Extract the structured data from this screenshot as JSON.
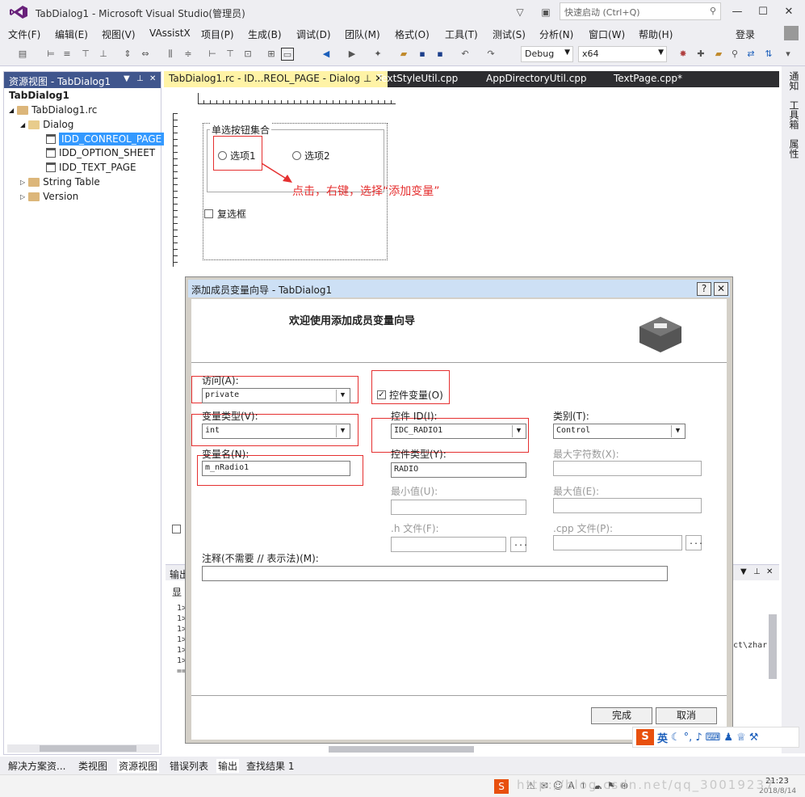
{
  "window": {
    "title": "TabDialog1 - Microsoft Visual Studio(管理员)",
    "quick_launch": "快速启动 (Ctrl+Q)"
  },
  "menu": [
    "文件(F)",
    "编辑(E)",
    "视图(V)",
    "VAssistX",
    "项目(P)",
    "生成(B)",
    "调试(D)",
    "团队(M)",
    "格式(O)",
    "工具(T)",
    "测试(S)",
    "分析(N)",
    "窗口(W)",
    "帮助(H)"
  ],
  "signin": "登录",
  "toolbar": {
    "config": "Debug",
    "platform": "x64"
  },
  "resource_view": {
    "title": "资源视图 - TabDialog1",
    "tree": [
      "TabDialog1",
      "TabDialog1.rc",
      "Dialog",
      "IDD_CONREOL_PAGE",
      "IDD_OPTION_SHEET",
      "IDD_TEXT_PAGE",
      "String Table",
      "Version"
    ]
  },
  "tabs": [
    "TabDialog1.rc - ID...REOL_PAGE - Dialog",
    "TextStyleUtil.cpp",
    "AppDirectoryUtil.cpp",
    "TextPage.cpp*"
  ],
  "right_tools": [
    "通知",
    "工具箱",
    "属性"
  ],
  "design": {
    "group_label": "单选按钮集合",
    "radio1": "选项1",
    "radio2": "选项2",
    "checkbox": "复选框",
    "annotation": "点击，右键，选择“添加变量”"
  },
  "output": {
    "header": "输出",
    "show": "显",
    "lines": [
      "1>",
      "1>",
      "1>",
      "1>",
      "1>",
      "1>",
      "=="
    ],
    "path_tail": "ct\\zhar"
  },
  "bottom_tabs": {
    "left": [
      "解决方案资...",
      "类视图",
      "资源视图"
    ],
    "right": [
      "错误列表",
      "输出",
      "查找结果 1"
    ]
  },
  "dialog": {
    "title": "添加成员变量向导 - TabDialog1",
    "help": "?",
    "close": "✕",
    "welcome": "欢迎使用添加成员变量向导",
    "access_label": "访问(A):",
    "access_value": "private",
    "control_var_label": "控件变量(O)",
    "var_type_label": "变量类型(V):",
    "var_type_value": "int",
    "control_id_label": "控件 ID(I):",
    "control_id_value": "IDC_RADIO1",
    "category_label": "类别(T):",
    "category_value": "Control",
    "var_name_label": "变量名(N):",
    "var_name_value": "m_nRadio1",
    "control_type_label": "控件类型(Y):",
    "control_type_value": "RADIO",
    "max_chars_label": "最大字符数(X):",
    "min_label": "最小值(U):",
    "max_label": "最大值(E):",
    "h_file_label": ".h 文件(F):",
    "cpp_file_label": ".cpp 文件(P):",
    "browse": "...",
    "comment_label": "注释(不需要 // 表示法)(M):",
    "finish": "完成",
    "cancel": "取消"
  },
  "ime": {
    "mode": "英"
  },
  "taskbar": {
    "time": "21:23",
    "date": "2018/8/14"
  },
  "watermark": "http://blog.csdn.net/qq_30019237"
}
